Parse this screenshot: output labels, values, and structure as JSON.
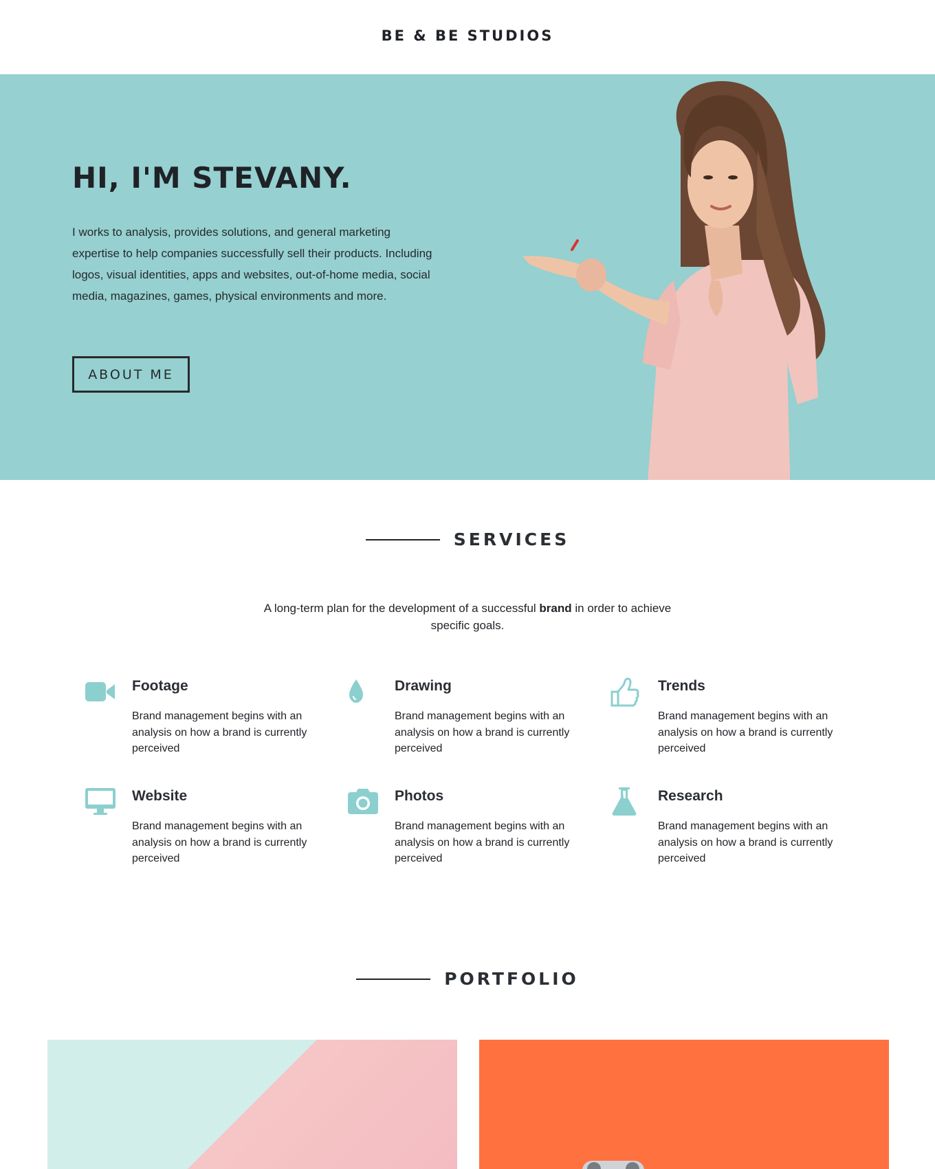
{
  "header": {
    "brand": "BE & BE STUDIOS"
  },
  "hero": {
    "title": "HI, I'M STEVANY.",
    "text": "I works to analysis, provides solutions, and general marketing expertise to help companies successfully sell their products. Including logos, visual identities, apps and websites, out-of-home media, social media, magazines, games, physical environments and more.",
    "button": "ABOUT ME"
  },
  "services": {
    "heading": "SERVICES",
    "intro_before": "A long-term plan for the development of a successful ",
    "intro_bold": "brand",
    "intro_after": " in order to achieve specific goals.",
    "items": [
      {
        "title": "Footage",
        "desc": "Brand management begins with an analysis on how a brand is currently perceived",
        "icon": "video-camera-icon"
      },
      {
        "title": "Drawing",
        "desc": "Brand management begins with an analysis on how a brand is currently perceived",
        "icon": "droplet-icon"
      },
      {
        "title": "Trends",
        "desc": "Brand management begins with an analysis on how a brand is currently perceived",
        "icon": "thumbs-up-icon"
      },
      {
        "title": "Website",
        "desc": "Brand management begins with an analysis on how a brand is currently perceived",
        "icon": "monitor-icon"
      },
      {
        "title": "Photos",
        "desc": "Brand management begins with an analysis on how a brand is currently perceived",
        "icon": "camera-icon"
      },
      {
        "title": "Research",
        "desc": "Brand management begins with an analysis on how a brand is currently perceived",
        "icon": "flask-icon"
      }
    ]
  },
  "portfolio": {
    "heading": "PORTFOLIO"
  },
  "colors": {
    "hero_bg": "#96d0d0",
    "accent_icon": "#8ccfcf",
    "text_dark": "#1f2227",
    "dress": "#f2c4be",
    "portfolio_orange": "#ff7240"
  }
}
